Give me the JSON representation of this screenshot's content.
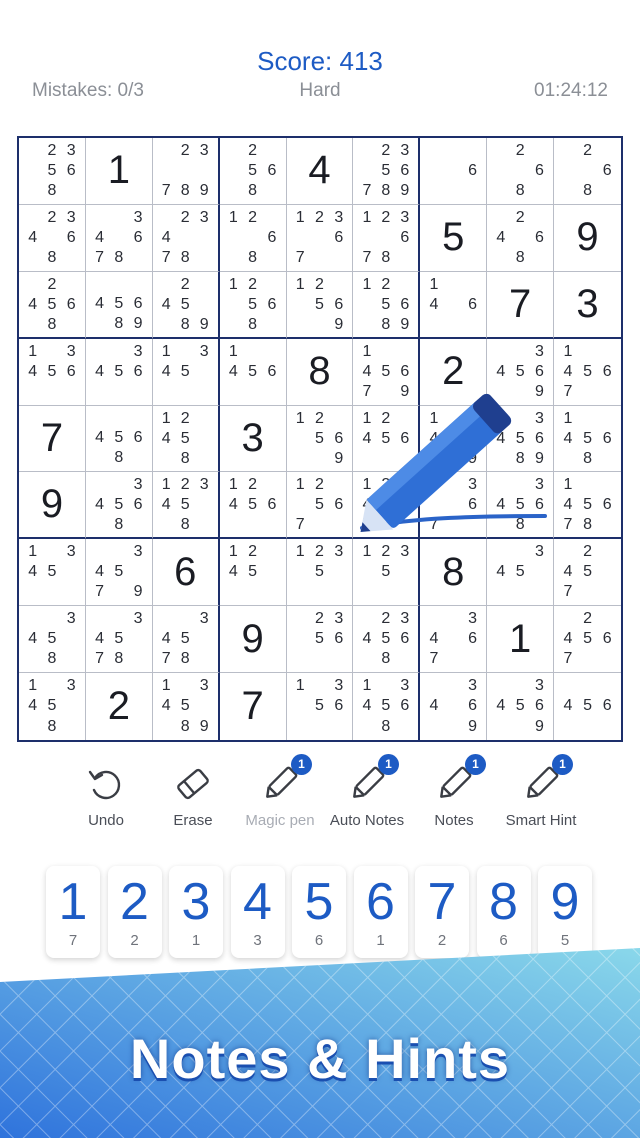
{
  "header": {
    "score": "Score: 413",
    "mistakes": "Mistakes: 0/3",
    "difficulty": "Hard",
    "timer": "01:24:12"
  },
  "board": [
    [
      {
        "n": "23 56 8  "
      },
      {
        "v": "1"
      },
      {
        "n": " 23 789"
      },
      {
        "n": "2  56 8  "
      },
      {
        "v": "4"
      },
      {
        "n": " 23 56789"
      },
      {
        "n": "     6   "
      },
      {
        "n": "2    6 8 "
      },
      {
        "n": "2    6 8 "
      }
    ],
    [
      {
        "n": " 234 6 8 "
      },
      {
        "n": "  34 678 "
      },
      {
        "n": " 234   78 "
      },
      {
        "n": "12    6 8 "
      },
      {
        "n": "123  6 7  "
      },
      {
        "n": "123  6 78 "
      },
      {
        "v": "5"
      },
      {
        "n": " 2 4 6 8 "
      },
      {
        "v": "9"
      }
    ],
    [
      {
        "n": " 2 456 8 "
      },
      {
        "n": "   456 89"
      },
      {
        "n": " 2 45  89"
      },
      {
        "n": "12  56 8 "
      },
      {
        "n": "12  56  9"
      },
      {
        "n": "12  56 89"
      },
      {
        "n": "1  4 6   "
      },
      {
        "v": "7"
      },
      {
        "v": "3"
      }
    ],
    [
      {
        "n": "1 3456   "
      },
      {
        "n": "  3456   "
      },
      {
        "n": "1 345    "
      },
      {
        "n": "1  456   "
      },
      {
        "v": "8"
      },
      {
        "n": "1  4567 9"
      },
      {
        "v": "2"
      },
      {
        "n": "  3456 9 "
      },
      {
        "n": "1  4567  "
      }
    ],
    [
      {
        "v": "7"
      },
      {
        "n": "   456 8 "
      },
      {
        "n": "12 45  8 "
      },
      {
        "v": "3"
      },
      {
        "n": "12  56  9"
      },
      {
        "n": "12 456   "
      },
      {
        "n": "1  4 6  9"
      },
      {
        "n": "  3456 89"
      },
      {
        "n": "1  456 8 "
      }
    ],
    [
      {
        "v": "9"
      },
      {
        "n": "  3456 8 "
      },
      {
        "n": "12345  8 "
      },
      {
        "n": "12 456   "
      },
      {
        "n": "12  56 7  "
      },
      {
        "n": "12 456 7  "
      },
      {
        "n": "  3 6 7  "
      },
      {
        "n": "  3456 8 "
      },
      {
        "n": "1  45678 "
      }
    ],
    [
      {
        "n": "1 345    "
      },
      {
        "n": "  345 7 9"
      },
      {
        "v": "6"
      },
      {
        "n": "12 45    "
      },
      {
        "n": "123 5    "
      },
      {
        "n": "123 5    "
      },
      {
        "v": "8"
      },
      {
        "n": "  345    "
      },
      {
        "n": " 2 45  7 "
      }
    ],
    [
      {
        "n": "  345  8 "
      },
      {
        "n": "  345 78 "
      },
      {
        "n": "  345 78 "
      },
      {
        "v": "9"
      },
      {
        "n": " 23 56   "
      },
      {
        "n": " 23456 8 "
      },
      {
        "n": "  34 6 7 "
      },
      {
        "v": "1"
      },
      {
        "n": " 2 4567  "
      }
    ],
    [
      {
        "n": "1 345  8 "
      },
      {
        "v": "2"
      },
      {
        "n": "1 345  89"
      },
      {
        "v": "7"
      },
      {
        "n": "1 3 56   "
      },
      {
        "n": "1 3456 8 "
      },
      {
        "n": "  34 6  9"
      },
      {
        "n": "  3456  9"
      },
      {
        "n": "   456   "
      }
    ]
  ],
  "toolbar": {
    "undo": "Undo",
    "erase": "Erase",
    "magic_pen": "Magic pen",
    "auto_notes": "Auto Notes",
    "notes": "Notes",
    "smart_hint": "Smart Hint",
    "badge_magic_pen": "1",
    "badge_auto_notes": "1",
    "badge_notes": "1",
    "badge_smart_hint": "1"
  },
  "numpad": [
    {
      "digit": "1",
      "count": "7"
    },
    {
      "digit": "2",
      "count": "2"
    },
    {
      "digit": "3",
      "count": "1"
    },
    {
      "digit": "4",
      "count": "3"
    },
    {
      "digit": "5",
      "count": "6"
    },
    {
      "digit": "6",
      "count": "1"
    },
    {
      "digit": "7",
      "count": "2"
    },
    {
      "digit": "8",
      "count": "6"
    },
    {
      "digit": "9",
      "count": "5"
    }
  ],
  "banner": {
    "text": "Notes & Hints"
  },
  "colors": {
    "accent": "#1d5bc4",
    "grid_bold": "#1d2f6b",
    "banner_top": "#3b7fe0",
    "banner_bottom": "#7fd3e8"
  },
  "icons": {
    "undo": "undo-arrow-icon",
    "erase": "eraser-icon",
    "pen": "pencil-icon"
  }
}
